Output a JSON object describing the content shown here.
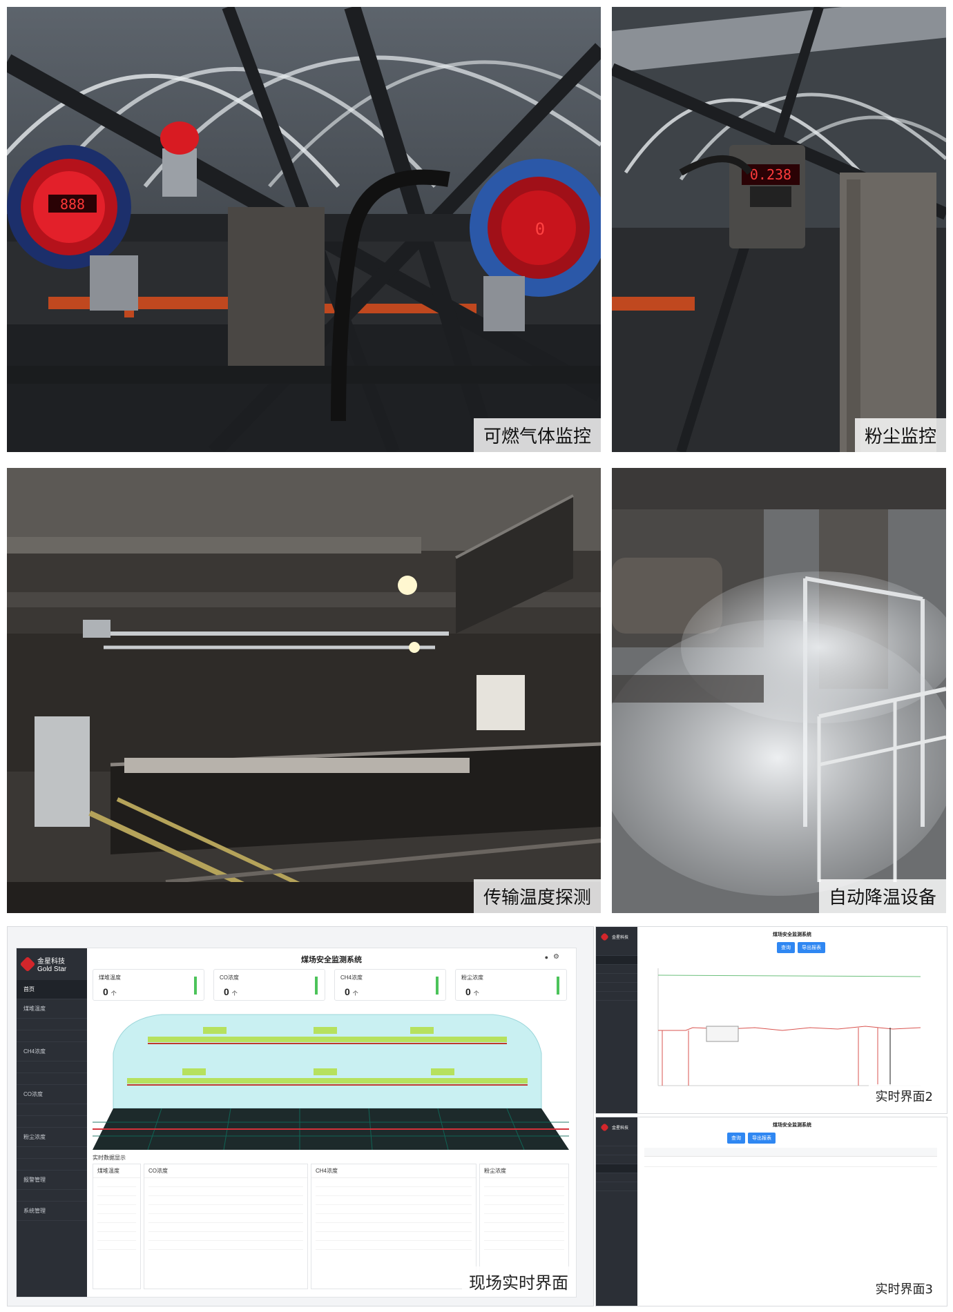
{
  "photos": {
    "p1_caption": "可燃气体监控",
    "p2_caption": "粉尘监控",
    "p3_caption": "传输温度探测",
    "p4_caption": "自动降温设备"
  },
  "gauges": {
    "g1_reading": "888",
    "g2_reading": "0",
    "dust_reading": "0.238"
  },
  "screens": {
    "main_caption": "现场实时界面",
    "s2_caption": "实时界面2",
    "s3_caption": "实时界面3",
    "app_title": "煤场安全监测系统",
    "brand_cn": "金星科技",
    "brand_en": "Gold Star",
    "stat1_label": "煤堆温度",
    "stat2_label": "CO浓度",
    "stat3_label": "CH4浓度",
    "stat4_label": "粉尘浓度",
    "stat_value": "0",
    "stat_unit": "个",
    "realtime_title": "实时数据显示",
    "btn_search": "查询",
    "btn_export": "导出报表",
    "side_home": "首页",
    "side_temp": "煤堆温度",
    "side_co": "CO浓度",
    "side_ch4": "CH4浓度",
    "side_dust": "粉尘浓度",
    "side_alarm": "报警管理",
    "side_system": "系统管理"
  }
}
